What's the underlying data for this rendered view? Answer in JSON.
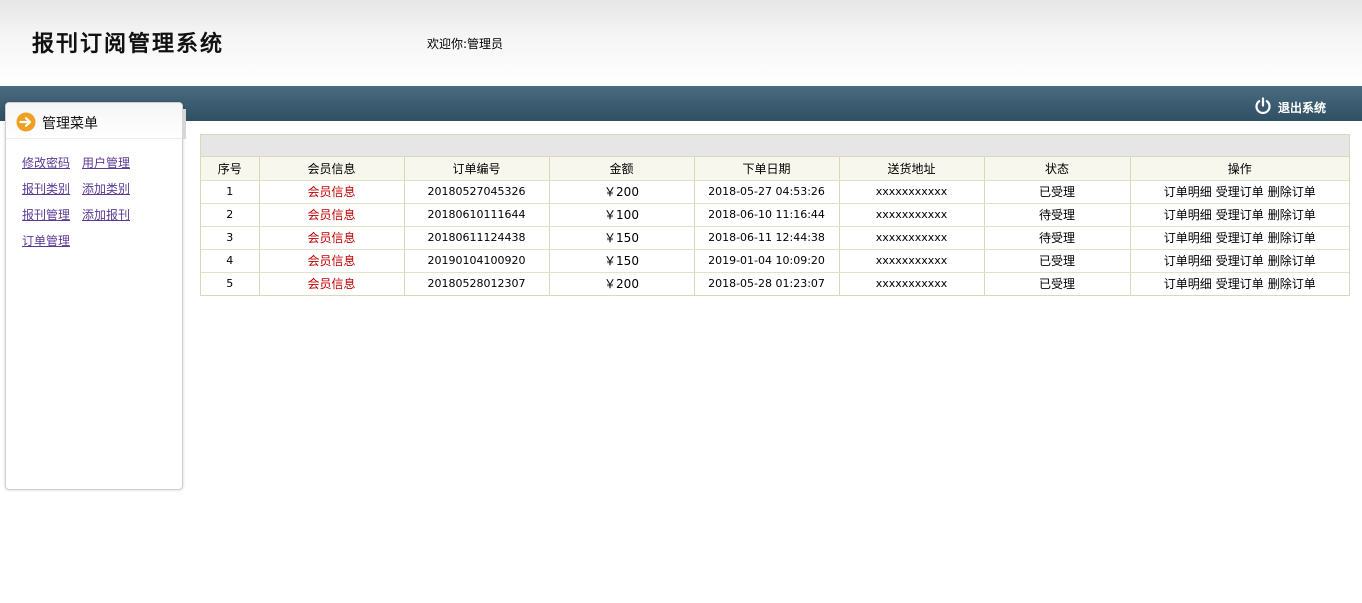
{
  "header": {
    "app_title": "报刊订阅管理系统",
    "welcome": "欢迎你:管理员"
  },
  "nav": {
    "logout_label": "退出系统"
  },
  "sidebar": {
    "title": "管理菜单",
    "links": [
      [
        "修改密码",
        "用户管理"
      ],
      [
        "报刊类别",
        "添加类别"
      ],
      [
        "报刊管理",
        "添加报刊"
      ],
      [
        "订单管理"
      ]
    ]
  },
  "table": {
    "columns": [
      "序号",
      "会员信息",
      "订单编号",
      "金额",
      "下单日期",
      "送货地址",
      "状态",
      "操作"
    ],
    "rows": [
      {
        "index": "1",
        "member": "会员信息",
        "order_no": "20180527045326",
        "amount": "￥200",
        "date": "2018-05-27 04:53:26",
        "address": "xxxxxxxxxxx",
        "status": "已受理"
      },
      {
        "index": "2",
        "member": "会员信息",
        "order_no": "20180610111644",
        "amount": "￥100",
        "date": "2018-06-10 11:16:44",
        "address": "xxxxxxxxxxx",
        "status": "待受理"
      },
      {
        "index": "3",
        "member": "会员信息",
        "order_no": "20180611124438",
        "amount": "￥150",
        "date": "2018-06-11 12:44:38",
        "address": "xxxxxxxxxxx",
        "status": "待受理"
      },
      {
        "index": "4",
        "member": "会员信息",
        "order_no": "20190104100920",
        "amount": "￥150",
        "date": "2019-01-04 10:09:20",
        "address": "xxxxxxxxxxx",
        "status": "已受理"
      },
      {
        "index": "5",
        "member": "会员信息",
        "order_no": "20180528012307",
        "amount": "￥200",
        "date": "2018-05-28 01:23:07",
        "address": "xxxxxxxxxxx",
        "status": "已受理"
      }
    ],
    "actions": [
      "订单明细",
      "受理订单",
      "删除订单"
    ]
  },
  "colors": {
    "navbar": "#2f4f63",
    "member_link": "#c00000",
    "menu_link": "#5b3a93",
    "arrow_icon": "#f0a020"
  },
  "icons": {
    "logout": "power-icon",
    "menu": "arrow-right-circle-icon"
  }
}
